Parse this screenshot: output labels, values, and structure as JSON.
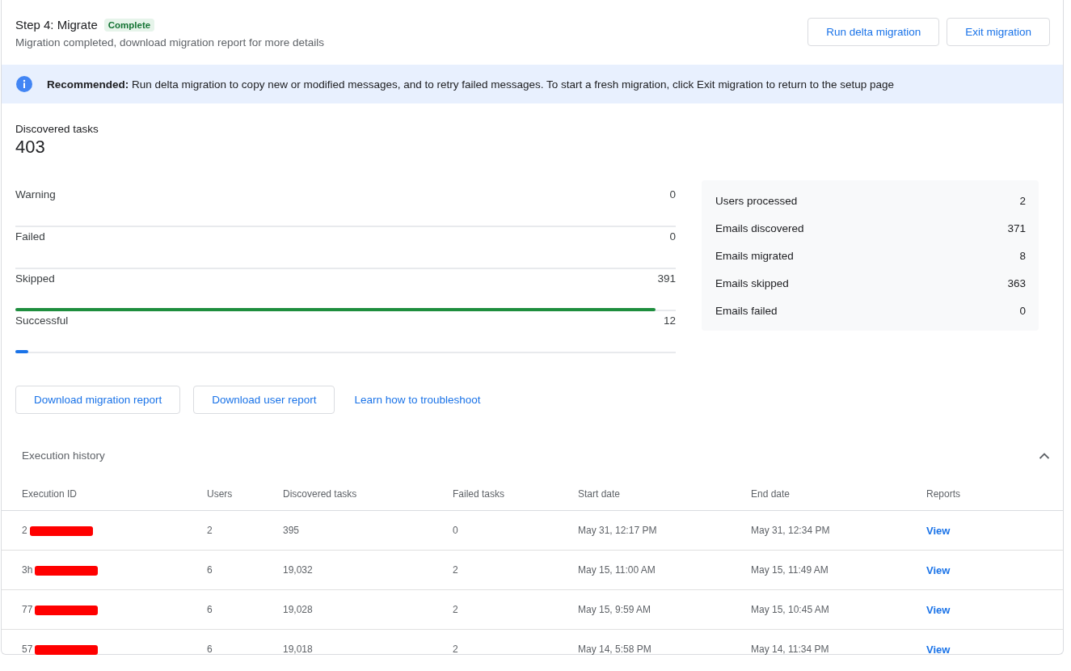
{
  "header": {
    "title": "Step 4: Migrate",
    "status": "Complete",
    "subtitle": "Migration completed, download migration report for more details",
    "buttons": [
      "Run delta migration",
      "Exit migration"
    ]
  },
  "banner": {
    "lead": "Recommended:",
    "text": "Run delta migration to copy new or modified messages, and to retry failed messages. To start a fresh migration, click Exit migration to return to the setup page"
  },
  "discovered": {
    "label": "Discovered tasks",
    "value": "403"
  },
  "progress": [
    {
      "label": "Warning",
      "count": "0"
    },
    {
      "label": "Failed",
      "count": "0"
    },
    {
      "label": "Skipped",
      "count": "391",
      "level": 0.97,
      "color": "#1e8e3e"
    },
    {
      "label": "Successful",
      "count": "12",
      "level": 0.02,
      "color": "#1a73e8"
    }
  ],
  "summary": [
    {
      "label": "Users processed",
      "value": "2"
    },
    {
      "label": "Emails discovered",
      "value": "371"
    },
    {
      "label": "Emails migrated",
      "value": "8"
    },
    {
      "label": "Emails skipped",
      "value": "363"
    },
    {
      "label": "Emails failed",
      "value": "0"
    }
  ],
  "actions": [
    {
      "kind": "button",
      "label": "Download migration report"
    },
    {
      "kind": "button",
      "label": "Download user report"
    },
    {
      "kind": "link",
      "label": "Learn how to troubleshoot"
    }
  ],
  "history": {
    "title": "Execution history",
    "expanded": true,
    "columns": [
      "Execution ID",
      "Users",
      "Discovered tasks",
      "Failed tasks",
      "Start date",
      "End date",
      "Reports"
    ],
    "rows": [
      {
        "id": "2",
        "redacted": true,
        "users": "2",
        "discovered": "395",
        "failed": "0",
        "start": "May 31, 12:17 PM",
        "end": "May 31, 12:34 PM",
        "report": "View"
      },
      {
        "id": "3h",
        "redacted": true,
        "users": "6",
        "discovered": "19,032",
        "failed": "2",
        "start": "May 15, 11:00 AM",
        "end": "May 15, 11:49 AM",
        "report": "View"
      },
      {
        "id": "77",
        "redacted": true,
        "users": "6",
        "discovered": "19,028",
        "failed": "2",
        "start": "May 15, 9:59 AM",
        "end": "May 15, 10:45 AM",
        "report": "View"
      },
      {
        "id": "57",
        "redacted": true,
        "users": "6",
        "discovered": "19,018",
        "failed": "2",
        "start": "May 14, 5:58 PM",
        "end": "May 14, 11:34 PM",
        "report": "View"
      }
    ]
  }
}
